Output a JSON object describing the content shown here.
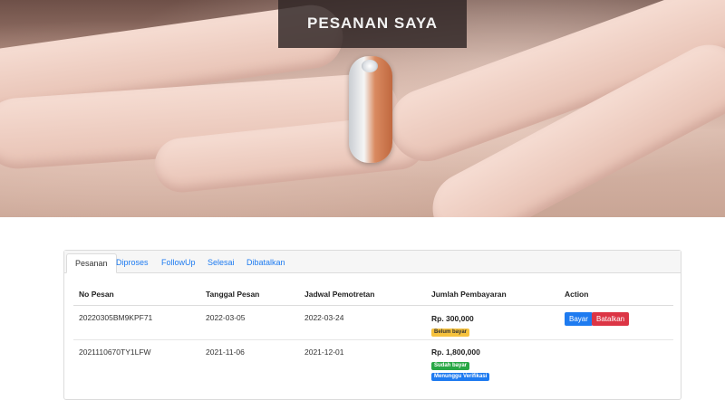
{
  "hero": {
    "title": "PESANAN SAYA"
  },
  "tabs": [
    {
      "label": "Pesanan",
      "active": true
    },
    {
      "label": "Diproses",
      "active": false
    },
    {
      "label": "FollowUp",
      "active": false
    },
    {
      "label": "Selesai",
      "active": false
    },
    {
      "label": "Dibatalkan",
      "active": false
    }
  ],
  "table": {
    "headers": {
      "order_no": "No Pesan",
      "order_date": "Tanggal Pesan",
      "shoot_date": "Jadwal Pemotretan",
      "amount": "Jumlah Pembayaran",
      "action": "Action"
    },
    "rows": [
      {
        "order_no": "20220305BM9KPF71",
        "order_date": "2022-03-05",
        "shoot_date": "2022-03-24",
        "amount": "Rp. 300,000",
        "badges": [
          "Belum bayar"
        ],
        "actions": {
          "pay": "Bayar",
          "cancel": "Batalkan"
        }
      },
      {
        "order_no": "2021110670TY1LFW",
        "order_date": "2021-11-06",
        "shoot_date": "2021-12-01",
        "amount": "Rp. 1,800,000",
        "badges": [
          "Sudah bayar",
          "Menunggu Verifikasi"
        ]
      }
    ]
  },
  "colors": {
    "link": "#1e7bf0",
    "badge_warning": "#f6c23e",
    "badge_success": "#28a745",
    "badge_primary": "#1e7bf0",
    "button_danger": "#dc3545"
  }
}
